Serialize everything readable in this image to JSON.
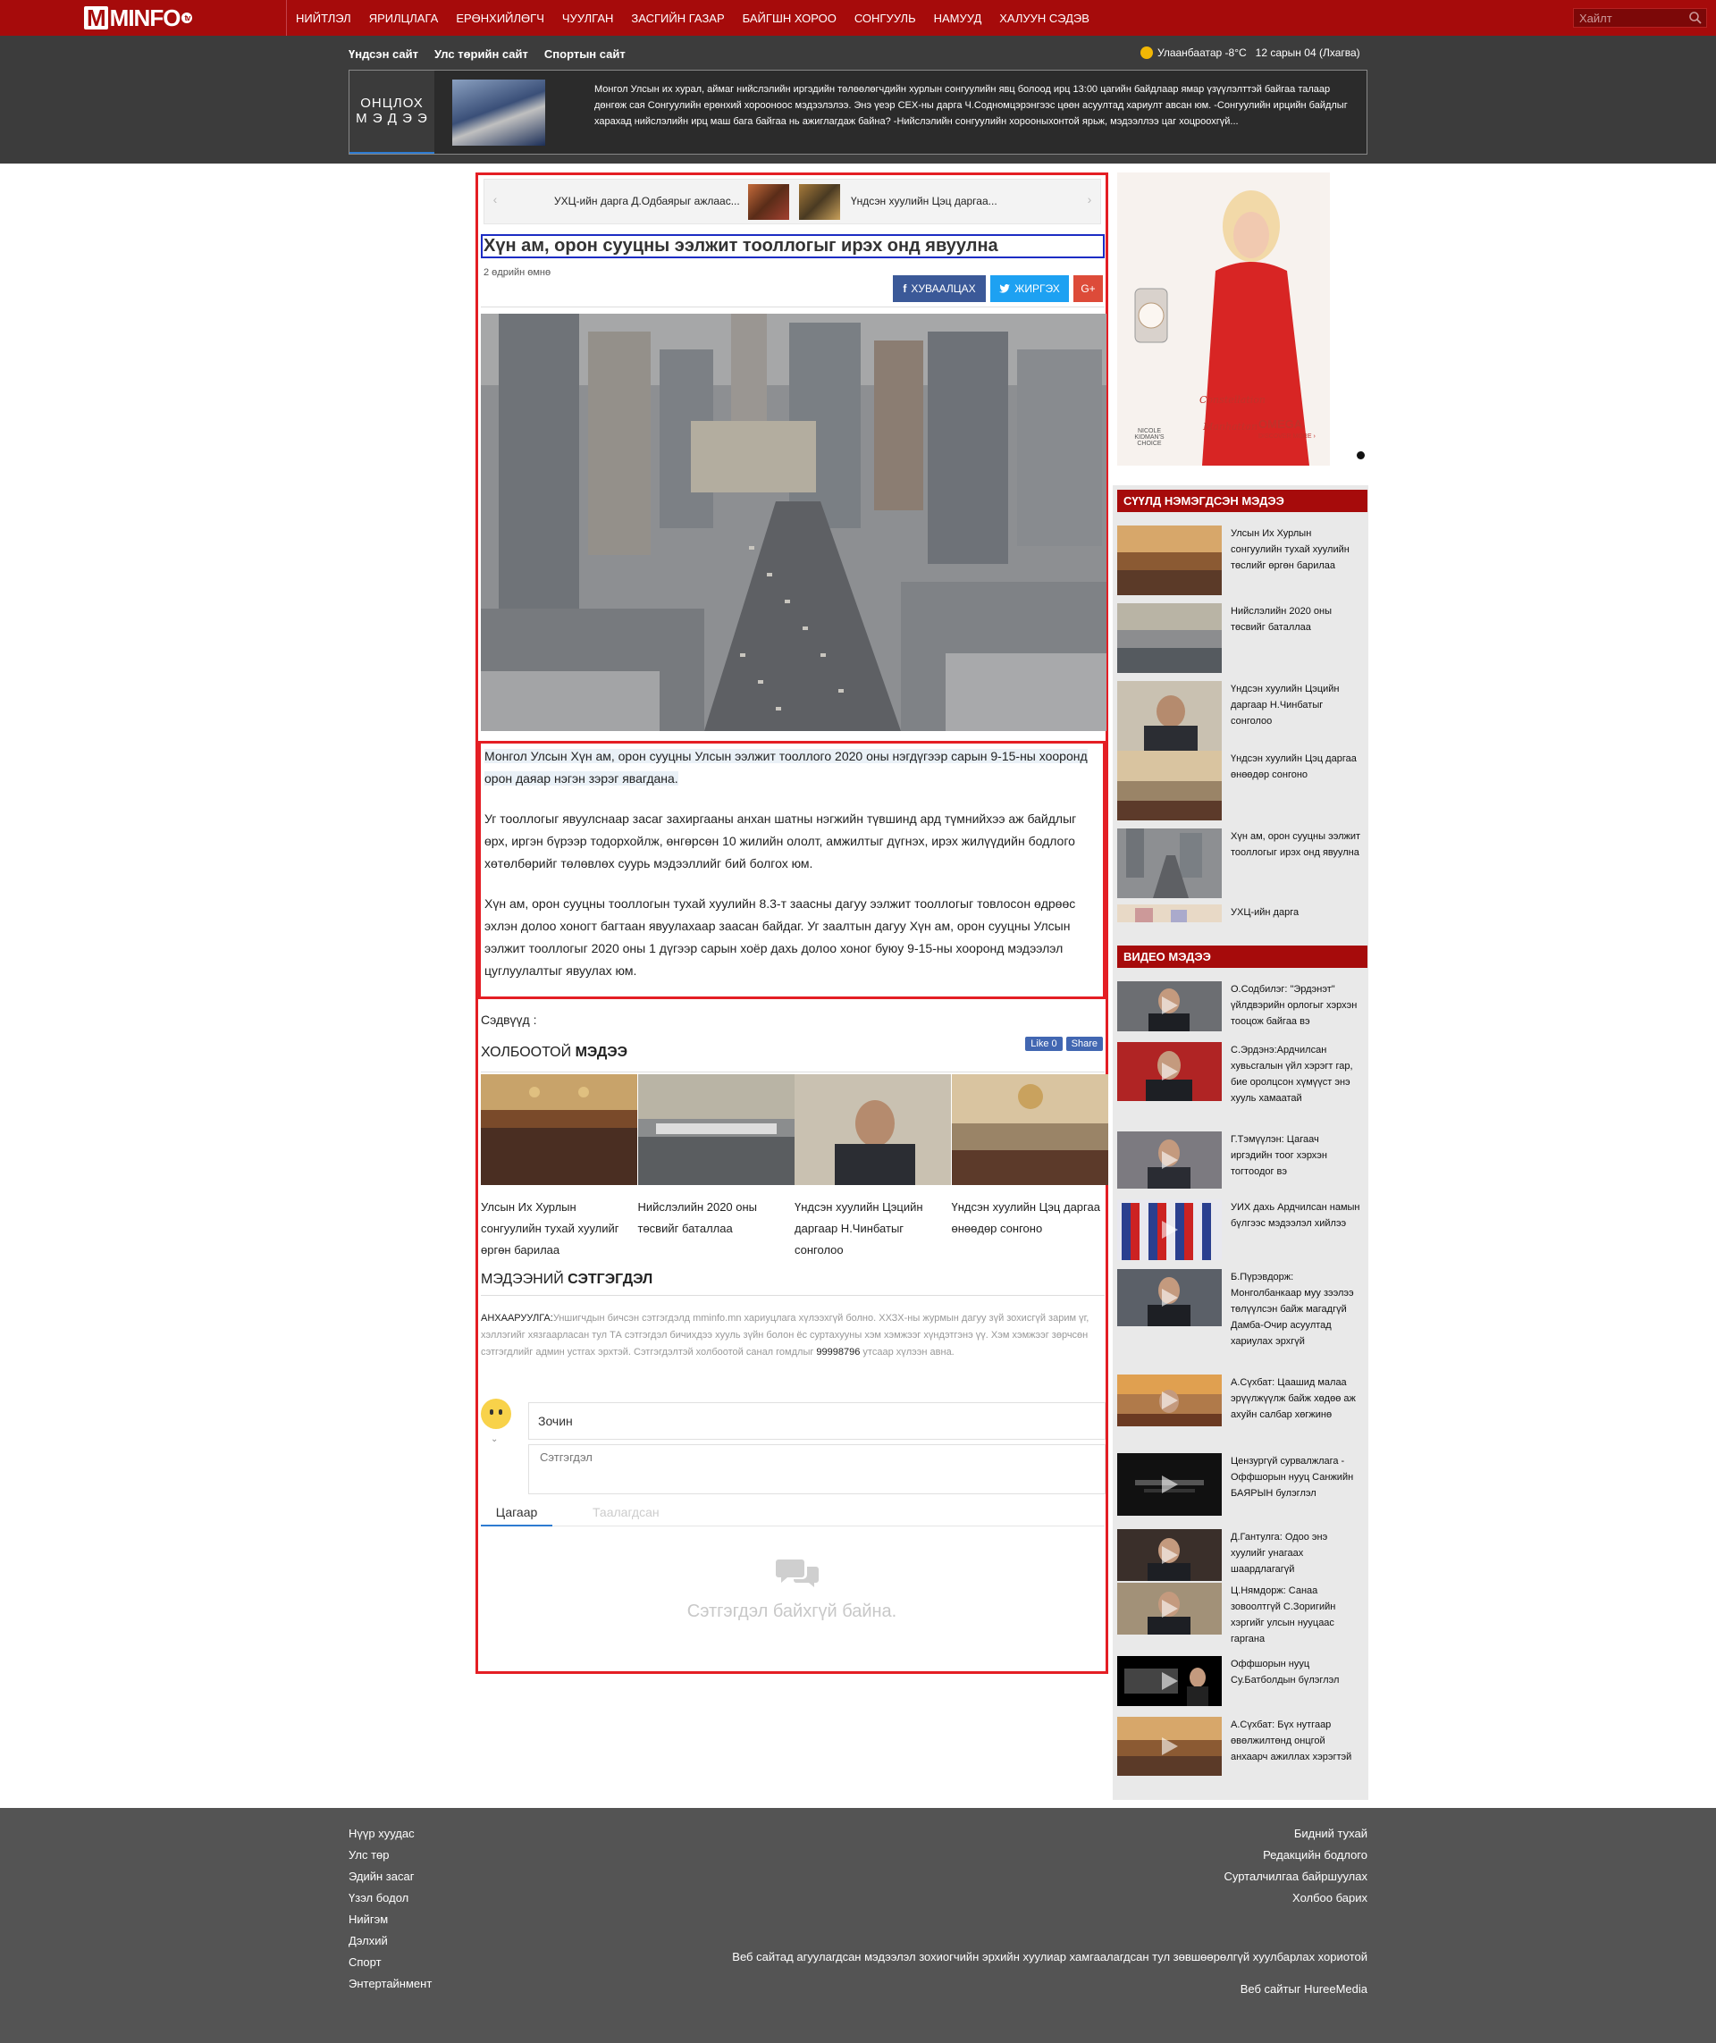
{
  "brand": {
    "logo_text": "MINFO",
    "logo_m": "M",
    "logo_tv": "tv"
  },
  "nav": {
    "items": [
      "НИЙТЛЭЛ",
      "ЯРИЛЦЛАГА",
      "ЕРӨНХИЙЛӨГЧ",
      "ЧУУЛГАН",
      "ЗАСГИЙН ГАЗАР",
      "БАЙГШН ХОРОО",
      "СОНГУУЛЬ",
      "НАМУУД",
      "ХАЛУУН СЭДЭВ"
    ],
    "search_placeholder": "Хайлт"
  },
  "sitelinks": [
    "Үндсэн сайт",
    "Улс төрийн сайт",
    "Спортын сайт"
  ],
  "weather": {
    "city_temp": "Улаанбаатар -8°C",
    "date": "12 сарын 04 (Лхагва)"
  },
  "breaking": {
    "label_line1": "ОНЦЛОХ",
    "label_line2": "М Э Д Э Э",
    "text": "Монгол Улсын их хурал, аймаг нийслэлийн иргэдийн төлөөлөгчдийн хурлын сонгуулийн явц болоод ирц 13:00 цагийн байдлаар ямар үзүүлэлттэй байгаа талаар дөнгөж сая Сонгуулийн ерөнхий хорооноос мэдээлэлээ. Энэ үеэр СЕХ-ны дарга Ч.Содномцэрэнгээс цөөн асуултад хариулт авсан юм. -Сонгуулийн ирцийн байдлыг харахад нийслэлийн ирц маш бага байгаа нь ажиглагдаж байна? -Нийслэлийн сонгуулийн хорооныхонтой ярьж, мэдээллээ цаг хоцроохгүй..."
  },
  "slider": {
    "item1": "УХЦ-ийн дарга Д.Одбаярыг ажлаас...",
    "item2": "Үндсэн хуулийн Цэц даргаа..."
  },
  "article": {
    "title": "Хүн ам, орон сууцны ээлжит тооллогыг ирэх онд явуулна",
    "time": "2 өдрийн өмнө",
    "share_fb": "ХУВААЛЦАХ",
    "share_tw": "ЖИРГЭХ",
    "share_gp": "G+",
    "p1": "Монгол Улсын Хүн ам, орон сууцны Улсын ээлжит тооллого 2020 оны нэгдүгээр сарын 9-15-ны хооронд орон даяар нэгэн зэрэг явагдана.",
    "p2": " Уг тооллогыг явуулснаар засаг захиргааны анхан шатны нэгжийн түвшинд ард түмнийхээ аж байдлыг өрх, иргэн бүрээр тодорхойлж, өнгөрсөн 10 жилийн ололт, амжилтыг дүгнэх, ирэх жилүүдийн бодлого хөтөлбөрийг төлөвлөх суурь мэдээллийг бий болгох юм.",
    "p3": "Хүн ам, орон сууцны тооллогын тухай хуулийн 8.3-т заасны дагуу ээлжит тооллогыг товлосон өдрөөс эхлэн долоо хоногт багтаан явуулахаар заасан байдаг. Уг заалтын дагуу Хүн ам, орон сууцны Улсын ээлжит тооллогыг 2020 оны 1 дүгээр сарын хоёр дахь долоо хоног буюу 9-15-ны хооронд мэдээлэл цуглуулалтыг явуулах юм.",
    "tags_label": "Сэдвүүд :"
  },
  "related": {
    "heading_light": "ХОЛБООТОЙ",
    "heading_bold": "МЭДЭЭ",
    "fb_like": "Like 0",
    "fb_share": "Share",
    "items": [
      "Улсын Их Хурлын сонгуулийн тухай хуулийг өргөн барилаа",
      "Нийслэлийн 2020 оны төсвийг баталлаа",
      "Үндсэн хуулийн Цэцийн даргаар Н.Чинбатыг сонголоо",
      "Үндсэн хуулийн Цэц даргаа өнөөдөр сонгоно"
    ]
  },
  "comments": {
    "heading_light": "МЭДЭЭНИЙ",
    "heading_bold": "СЭТГЭГДЭЛ",
    "notice_key": "АНХААРУУЛГА:",
    "notice_text": "Уншигчдын бичсэн сэтгэгдэлд mminfo.mn хариуцлага хүлээхгүй болно. ХХЗХ-ны журмын дагуу зүй зохисгүй зарим үг, хэллэгийг хязгаарласан тул ТА сэтгэгдэл бичихдээ хууль зүйн болон ёс суртахууны хэм хэмжээг хүндэтгэнэ үү. Хэм хэмжээг зөрчсөн сэтгэгдлийг админ устгах эрхтэй. Сэтгэгдэлтэй холбоотой санал гомдлыг ",
    "notice_phone": "99998796",
    "notice_end": " утсаар хүлээн авна.",
    "name_value": "Зочин",
    "comment_placeholder": "Сэтгэгдэл",
    "tab_new": "Цагаар",
    "tab_liked": "Таалагдсан",
    "empty": "Сэтгэгдэл байхгүй байна."
  },
  "ad": {
    "line1": "Constellation",
    "line2": "Manhattan",
    "brand": "OMEGA",
    "cta": "DISCOVER MORE ›",
    "note": "NICOLE KIDMAN'S CHOICE"
  },
  "latest": {
    "heading": "СҮҮЛД НЭМЭГДСЭН МЭДЭЭ",
    "items": [
      "Улсын Их Хурлын сонгуулийн тухай хуулийн төслийг өргөн барилаа",
      "Нийслэлийн 2020 оны төсвийг баталлаа",
      "Үндсэн хуулийн Цэцийн даргаар Н.Чинбатыг сонголоо",
      "Үндсэн хуулийн Цэц даргаа өнөөдөр сонгоно",
      "Хүн ам, орон сууцны ээлжит тооллогыг ирэх онд явуулна",
      "УХЦ-ийн дарга"
    ]
  },
  "videos": {
    "heading": "ВИДЕО МЭДЭЭ",
    "items": [
      "О.Содбилэг: \"Эрдэнэт\" үйлдвэрийн орлогыг хэрхэн тооцож байгаа вэ",
      "С.Эрдэнэ:Ардчилсан хувьсгалын үйл хэрэгт гар, бие оролцсон хүмүүст энэ хууль хамаатай",
      "Г.Тэмүүлэн: Цагаач иргэдийн тоог хэрхэн тогтоодог вэ",
      "УИХ дахь Ардчилсан намын бүлгээс мэдээлэл хийлээ",
      "Б.Пүрэвдорж: Монголбанкаар муу зээлээ төлүүлсэн байж магадгүй Дамба-Очир асуултад хариулах эрхгүй",
      "А.Сүхбат: Цаашид малаа эрүүлжүүлж байж хөдөө аж ахуйн салбар хөгжинө",
      "Цензургүй сурвалжлага - Оффшорын нууц Санжийн БАЯРЫН булэглэл",
      "Д.Гантулга: Одоо энэ хуулийг унагаах шаардлагагүй",
      "Ц.Нямдорж: Санаа зовоолтгүй С.Зоригийн хэргийг улсын нууцаас гаргана",
      "Оффшорын нууц Су.Батболдын бүлэглэл",
      "А.Сүхбат: Бүх нутгаар өвөлжилтөнд онцгой анхаарч ажиллах хэрэгтэй"
    ]
  },
  "footer": {
    "left": [
      "Нүүр хуудас",
      "Улс төр",
      "Эдийн засаг",
      "Үзэл бодол",
      "Нийгэм",
      "Дэлхий",
      "Спорт",
      "Энтертайнмент"
    ],
    "right": [
      "Бидний тухай",
      "Редакцийн бодлого",
      "Сурталчилгаа байршуулах",
      "Холбоо барих"
    ],
    "copyright": "Веб сайтад агуулагдсан мэдээлэл зохиогчийн эрхийн хуулиар хамгаалагдсан тул зөвшөөрөлгүй хуулбарлах хориотой",
    "powered": "Веб сайтыг HureeMedia"
  },
  "colors": {
    "brand_red": "#a60b0b",
    "highlight_red": "#e41e24",
    "title_blue": "#1c2cc4",
    "dark_band": "#3c3c3c",
    "footer": "#545454"
  }
}
